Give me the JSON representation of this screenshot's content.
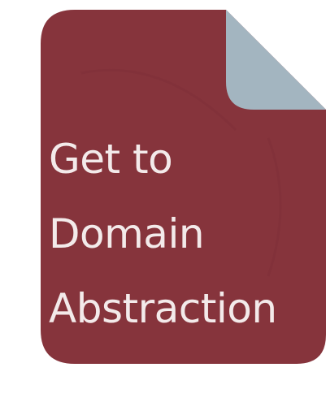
{
  "file_icon": {
    "title_lines": [
      "Get to",
      "Domain",
      "Abstraction"
    ],
    "icon": "document-file-icon",
    "colors": {
      "body": "#86343c",
      "fold": "#a3b5c0",
      "text": "#f3eaea"
    }
  }
}
